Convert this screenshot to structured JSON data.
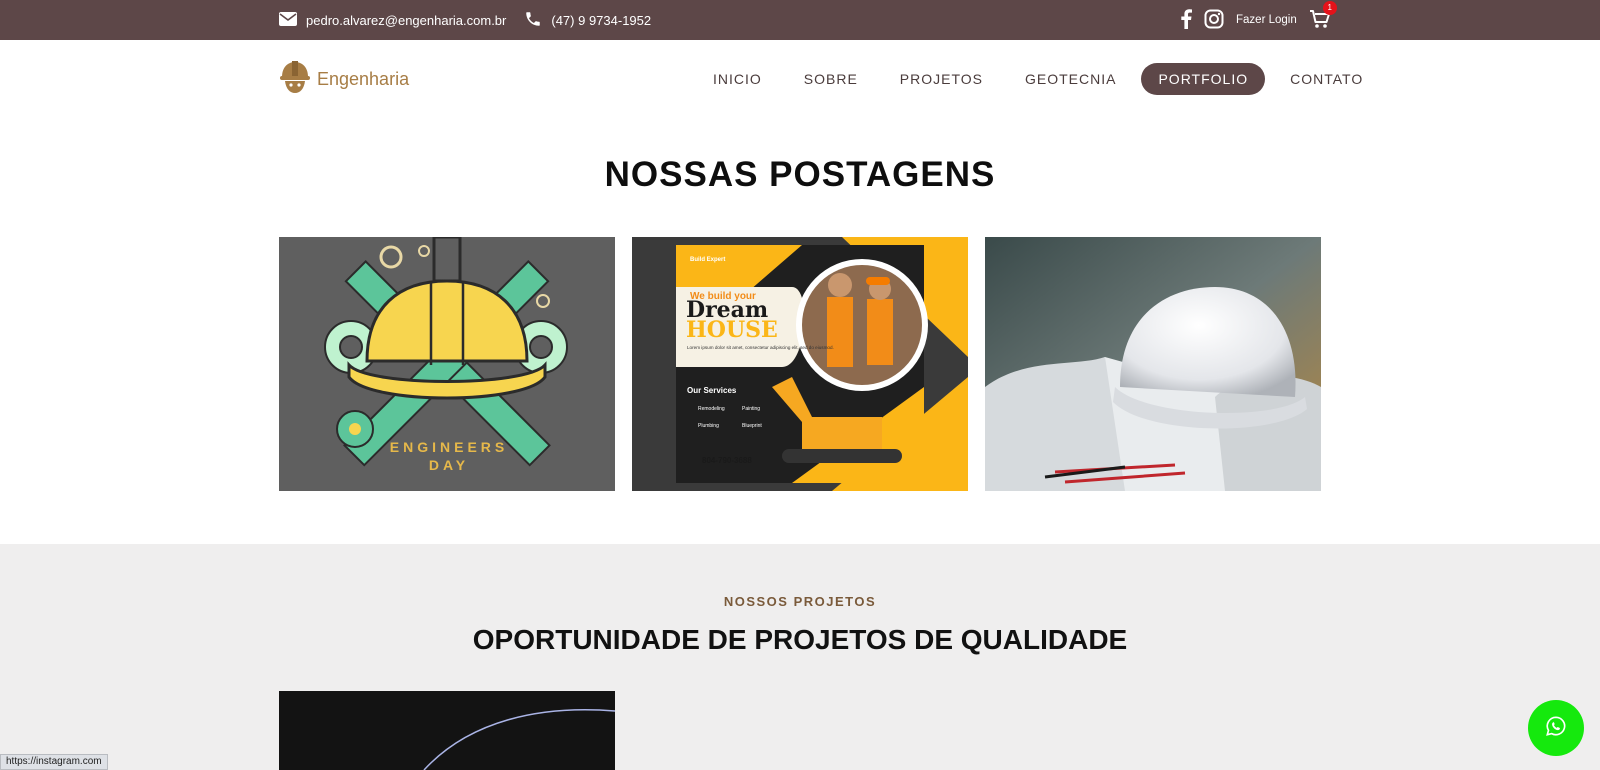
{
  "topbar": {
    "email": "pedro.alvarez@engenharia.com.br",
    "phone": "(47) 9 9734-1952",
    "login_label": "Fazer Login",
    "cart_count": "1",
    "icons": [
      "envelope-icon",
      "phone-icon",
      "facebook-icon",
      "instagram-icon",
      "cart-icon"
    ]
  },
  "header": {
    "logo_text": "Engenharia",
    "nav": [
      {
        "label": "INICIO"
      },
      {
        "label": "SOBRE"
      },
      {
        "label": "PROJETOS"
      },
      {
        "label": "GEOTECNIA"
      },
      {
        "label": "PORTFOLIO",
        "active": true
      },
      {
        "label": "CONTATO"
      }
    ]
  },
  "posts": {
    "title": "NOSSAS POSTAGENS",
    "items": [
      {
        "image": "engineers-day-illustration",
        "image_text": [
          "ENGINEERS",
          "DAY"
        ]
      },
      {
        "image": "dream-house-flyer",
        "image_text": {
          "brand": "Build Expert",
          "tagline": "We build your",
          "headline_1": "Dream",
          "headline_2": "HOUSE",
          "body": "Lorem ipsum dolor sit amet, consectetur adipiscing elit, sed do eiusmod.",
          "services_title": "Our Services",
          "services": [
            "Remodeling",
            "Painting",
            "Plumbing",
            "Blueprint"
          ],
          "phone": "804-790-3688"
        }
      },
      {
        "image": "white-hard-hat-on-blueprints"
      }
    ]
  },
  "projects": {
    "kicker": "NOSSOS PROJETOS",
    "heading": "OPORTUNIDADE DE PROJETOS DE QUALIDADE"
  },
  "status_bar": {
    "url": "https://instagram.com"
  },
  "colors": {
    "topbar": "#5d4748",
    "accent_gold": "#a77d45",
    "whatsapp": "#15e90d",
    "section_bg": "#efeeee"
  }
}
